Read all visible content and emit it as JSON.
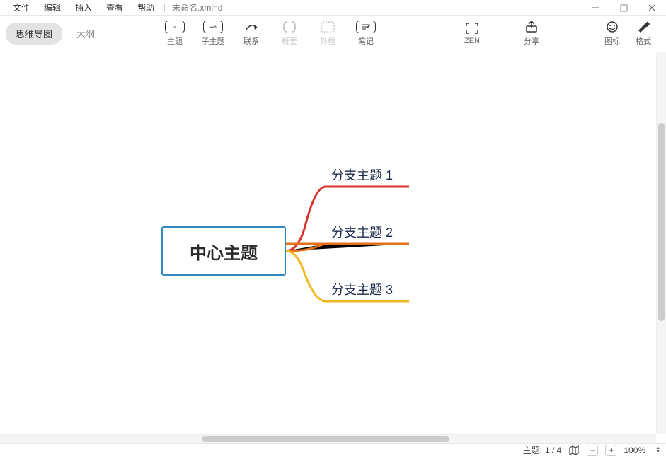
{
  "menu": {
    "items": [
      "文件",
      "编辑",
      "插入",
      "查看",
      "帮助"
    ],
    "filename": "未命名.xmind"
  },
  "view_tabs": {
    "mindmap": "思维导图",
    "outline": "大纲"
  },
  "toolbar": {
    "topic": "主题",
    "subtopic": "子主题",
    "relation": "联系",
    "summary": "概要",
    "boundary": "外框",
    "note": "笔记",
    "zen": "ZEN",
    "share": "分享",
    "marker": "图标",
    "format": "格式"
  },
  "mindmap": {
    "central": "中心主题",
    "branches": [
      "分支主题 1",
      "分支主题 2",
      "分支主题 3"
    ]
  },
  "statusbar": {
    "topic_label": "主题:",
    "topic_count": "1 / 4",
    "zoom": "100%"
  }
}
